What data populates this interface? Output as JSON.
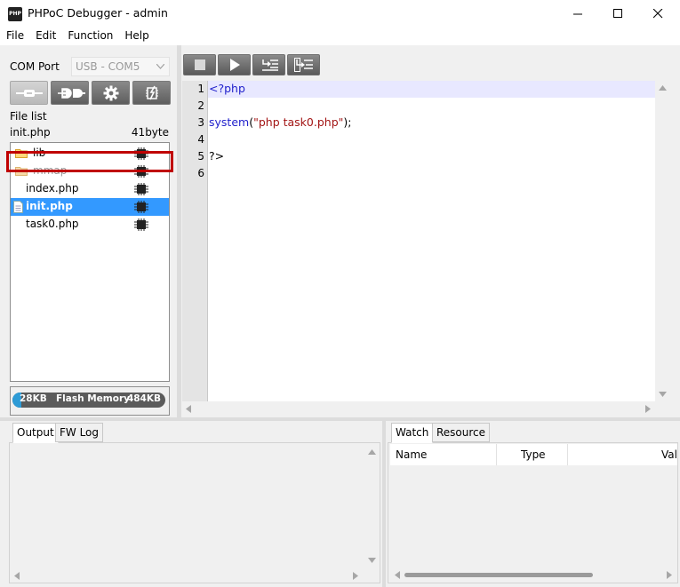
{
  "window": {
    "title": "PHPoC Debugger - admin",
    "app_icon_text": "PHP"
  },
  "menu": [
    "File",
    "Edit",
    "Function",
    "Help"
  ],
  "com_port": {
    "label": "COM Port",
    "value": "USB - COM5"
  },
  "file_panel": {
    "list_label": "File list",
    "selected_name": "init.php",
    "selected_size": "41byte",
    "items": [
      {
        "name": "lib",
        "type": "folder",
        "dimmed": false
      },
      {
        "name": "mmap",
        "type": "folder",
        "dimmed": true
      },
      {
        "name": "index.php",
        "type": "file",
        "selected": false
      },
      {
        "name": "init.php",
        "type": "file",
        "selected": true
      },
      {
        "name": "task0.php",
        "type": "file",
        "selected": false
      }
    ]
  },
  "memory": {
    "used": "28KB",
    "label": "Flash Memory",
    "total": "484KB",
    "fraction": 0.058
  },
  "editor": {
    "line_numbers": [
      "1",
      "2",
      "3",
      "4",
      "5",
      "6"
    ],
    "lines": {
      "l1": "<?php",
      "l3_fn": "system",
      "l3_open": "(",
      "l3_str": "\"php task0.php\"",
      "l3_close": ");",
      "l5": "?>"
    }
  },
  "output_tabs": [
    "Output",
    "FW Log"
  ],
  "watch_tabs": [
    "Watch",
    "Resource"
  ],
  "watch_columns": [
    "Name",
    "Type",
    "Val"
  ],
  "colors": {
    "selection": "#3399ff",
    "highlight_outline": "#c00000",
    "keyword": "#2222cc",
    "string": "#a31515",
    "memory_fill": "#2e9bd6"
  }
}
